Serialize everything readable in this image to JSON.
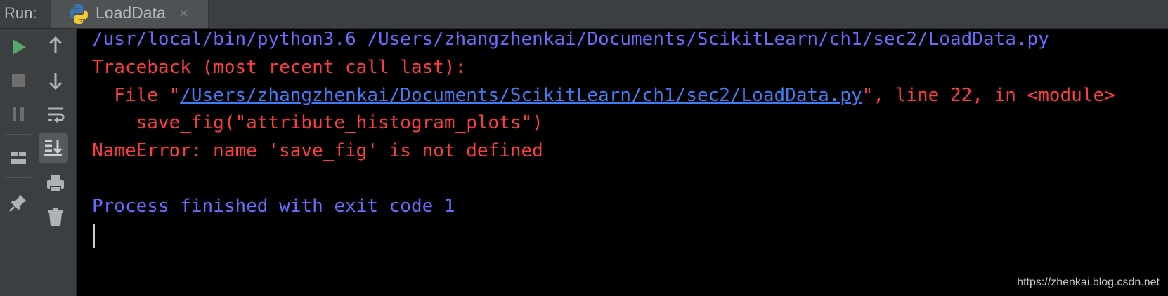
{
  "header": {
    "run_label": "Run:",
    "tab_title": "LoadData",
    "tab_close": "×"
  },
  "toolbar_left": [
    {
      "name": "run-icon"
    },
    {
      "name": "stop-icon"
    },
    {
      "name": "pause-icon"
    },
    {
      "name": "layout-icon"
    },
    {
      "name": "pin-icon"
    }
  ],
  "toolbar_right": [
    {
      "name": "up-arrow-icon"
    },
    {
      "name": "down-arrow-icon"
    },
    {
      "name": "soft-wrap-icon"
    },
    {
      "name": "scroll-to-end-icon",
      "active": true
    },
    {
      "name": "print-icon"
    },
    {
      "name": "trash-icon"
    }
  ],
  "console": {
    "command": "/usr/local/bin/python3.6 /Users/zhangzhenkai/Documents/ScikitLearn/ch1/sec2/LoadData.py",
    "traceback_header": "Traceback (most recent call last):",
    "file_prefix": "  File \"",
    "file_path": "/Users/zhangzhenkai/Documents/ScikitLearn/ch1/sec2/LoadData.py",
    "file_suffix": "\", line 22, in <module>",
    "code_line": "    save_fig(\"attribute_histogram_plots\")",
    "error": "NameError: name 'save_fig' is not defined",
    "process_status": "Process finished with exit code 1"
  },
  "colors": {
    "command": "#6b6bff",
    "error": "#ff3c3c",
    "link": "#3d7ef5",
    "background": "#000000",
    "panel": "#3c3f41"
  },
  "watermark": "https://zhenkai.blog.csdn.net"
}
